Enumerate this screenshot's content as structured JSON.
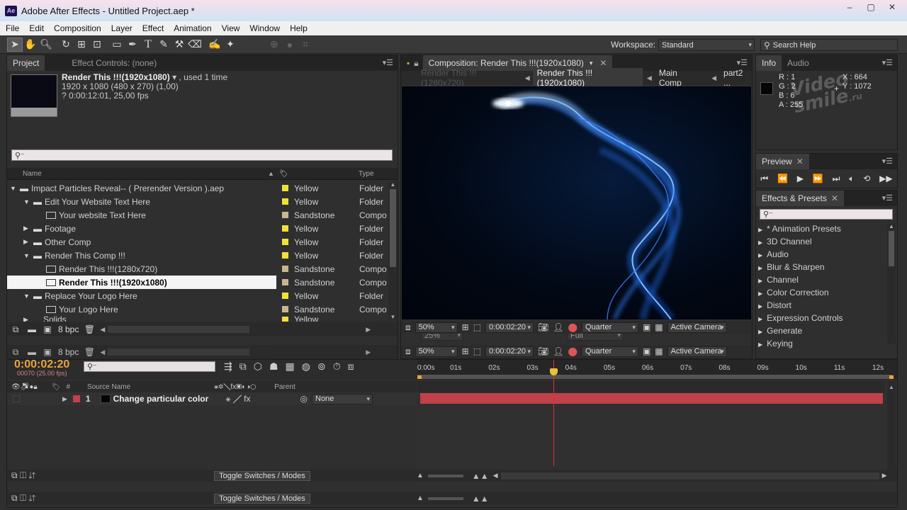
{
  "window": {
    "title": "Adobe After Effects - Untitled Project.aep *",
    "app_logo": "Ae",
    "buttons": [
      "–",
      "▢",
      "✕"
    ]
  },
  "menu": [
    "File",
    "Edit",
    "Composition",
    "Layer",
    "Effect",
    "Animation",
    "View",
    "Window",
    "Help"
  ],
  "toolbar": {
    "workspace_label": "Workspace:",
    "workspace_value": "Standard",
    "search_help": "Search Help"
  },
  "project": {
    "tabs": [
      "Project",
      "Effect Controls: (none)"
    ],
    "preview": {
      "name": "Render This !!!(1920x1080)",
      "used": "▾ , used 1 time",
      "dims": "1920 x 1080  (480 x 270) (1,00)",
      "duration": "? 0:00:12:01, 25,00 fps"
    },
    "search_placeholder": "⚲⁻",
    "columns": {
      "name": "Name",
      "type": "Type"
    },
    "rows": [
      {
        "name": "Impact Particles Reveal-- ( Prerender Version ).aep",
        "label": "Yellow",
        "color": "#f2e03a",
        "type": "Folder"
      },
      {
        "name": "Edit Your Website Text Here",
        "label": "Yellow",
        "color": "#f2e03a",
        "type": "Folder"
      },
      {
        "name": "Your website Text Here",
        "label": "Sandstone",
        "color": "#c9b68f",
        "type": "Compo"
      },
      {
        "name": "Footage",
        "label": "Yellow",
        "color": "#f2e03a",
        "type": "Folder"
      },
      {
        "name": "Other Comp",
        "label": "Yellow",
        "color": "#f2e03a",
        "type": "Folder"
      },
      {
        "name": "Render This Comp !!!",
        "label": "Yellow",
        "color": "#f2e03a",
        "type": "Folder"
      },
      {
        "name": "Render This !!!(1280x720)",
        "label": "Sandstone",
        "color": "#c9b68f",
        "type": "Compo"
      },
      {
        "name": "Render This !!!(1920x1080)",
        "label": "Sandstone",
        "color": "#c9b68f",
        "type": "Compo"
      },
      {
        "name": "Replace Your Logo Here",
        "label": "Yellow",
        "color": "#f2e03a",
        "type": "Folder"
      },
      {
        "name": "Your Logo Here",
        "label": "Sandstone",
        "color": "#c9b68f",
        "type": "Compo"
      },
      {
        "name": "Solids",
        "label": "Yellow",
        "color": "#f2e03a",
        "type": "Folder"
      }
    ],
    "bpc": "8 bpc"
  },
  "comp": {
    "tab": "Composition: Render This !!!(1920x1080)",
    "breadcrumbs": [
      "Render This !!!(1280x720)",
      "Render This !!!(1920x1080)",
      "Main Comp",
      "part2 ..."
    ],
    "zoom": "50%",
    "timecode": "0:00:02:20",
    "resolution": "Quarter",
    "camera": "Active Camera",
    "ghost_zoom": "25%",
    "ghost_res": "Full"
  },
  "info": {
    "tabs": [
      "Info",
      "Audio"
    ],
    "r": "R : 1",
    "g": "G : 2",
    "b": "B : 6",
    "a": "A : 255",
    "x": "X : 664",
    "y": "Y : 1072",
    "watermark": "Video smile",
    "watermark_ru": ".ru"
  },
  "preview": {
    "tab": "Preview"
  },
  "effects": {
    "tab": "Effects & Presets",
    "items": [
      "* Animation Presets",
      "3D Channel",
      "Audio",
      "Blur & Sharpen",
      "Channel",
      "Color Correction",
      "Distort",
      "Expression Controls",
      "Generate",
      "Keying"
    ]
  },
  "timeline": {
    "timecode": "0:00:02:20",
    "frames": "00070 (25.00 fps)",
    "ruler": [
      "0:00s",
      "01s",
      "02s",
      "03s",
      "04s",
      "05s",
      "06s",
      "07s",
      "08s",
      "09s",
      "10s",
      "11s",
      "12s"
    ],
    "columns": {
      "source": "Source Name",
      "parent": "Parent",
      "num": "#"
    },
    "layer": {
      "num": "1",
      "name": "Change particular color",
      "parent": "None"
    },
    "toggle": "Toggle Switches / Modes",
    "layer_color": "#c0414a",
    "playhead_pct": 0.289
  }
}
